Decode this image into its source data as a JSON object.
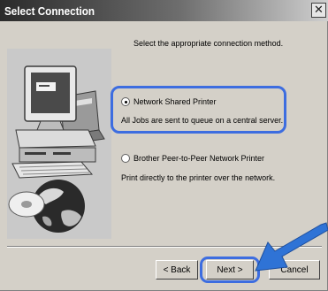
{
  "window": {
    "title": "Select Connection",
    "close_symbol": "✕"
  },
  "instruction": "Select the appropriate connection method.",
  "options": [
    {
      "label": "Network Shared Printer",
      "description": "All Jobs are sent to queue on a central server.",
      "selected": true
    },
    {
      "label": "Brother Peer-to-Peer Network Printer",
      "description": "Print directly to the printer over the network.",
      "selected": false
    }
  ],
  "buttons": {
    "back_label": "< Back",
    "next_label": "Next >",
    "cancel_label": "Cancel"
  },
  "colors": {
    "highlight": "#3d6de0",
    "pointer_arrow": "#2f73d6",
    "dialog_face": "#d4d0c8"
  },
  "icons": {
    "artwork": "computer-printer-globe-icon",
    "pointer": "blue-arrow-icon"
  }
}
